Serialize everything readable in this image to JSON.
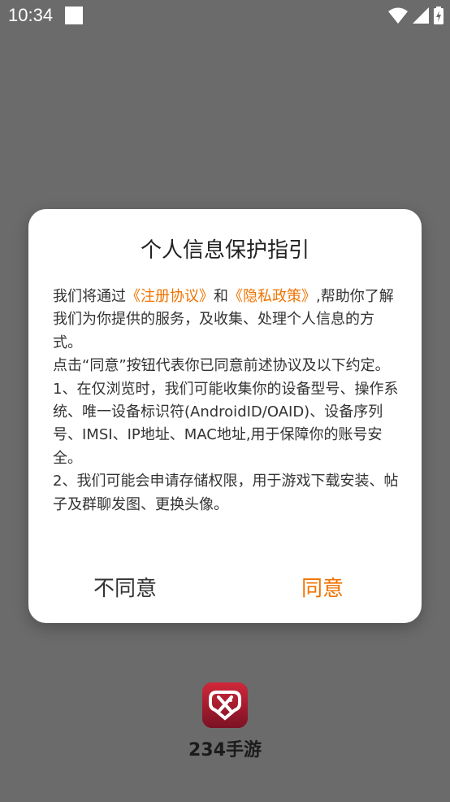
{
  "status_bar": {
    "time": "10:34"
  },
  "dialog": {
    "title": "个人信息保护指引",
    "body": {
      "p1_prefix": "我们将通过",
      "p1_link1": "《注册协议》",
      "p1_and": "和",
      "p1_link2": "《隐私政策》",
      "p1_suffix": ",帮助你了解我们为你提供的服务，及收集、处理个人信息的方式。",
      "p2": "点击“同意”按钮代表你已同意前述协议及以下约定。",
      "p3": "1、在仅浏览时，我们可能收集你的设备型号、操作系统、唯一设备标识符(AndroidID/OAID)、设备序列号、IMSI、IP地址、MAC地址,用于保障你的账号安全。",
      "p4": "2、我们可能会申请存储权限，用于游戏下载安装、帖子及群聊发图、更换头像。"
    },
    "disagree_label": "不同意",
    "agree_label": "同意"
  },
  "app": {
    "name": "234手游",
    "icon": "gamepad-heart-icon"
  },
  "colors": {
    "accent": "#f07300",
    "overlay": "#6b6b6b",
    "logo": "#8a1828"
  }
}
